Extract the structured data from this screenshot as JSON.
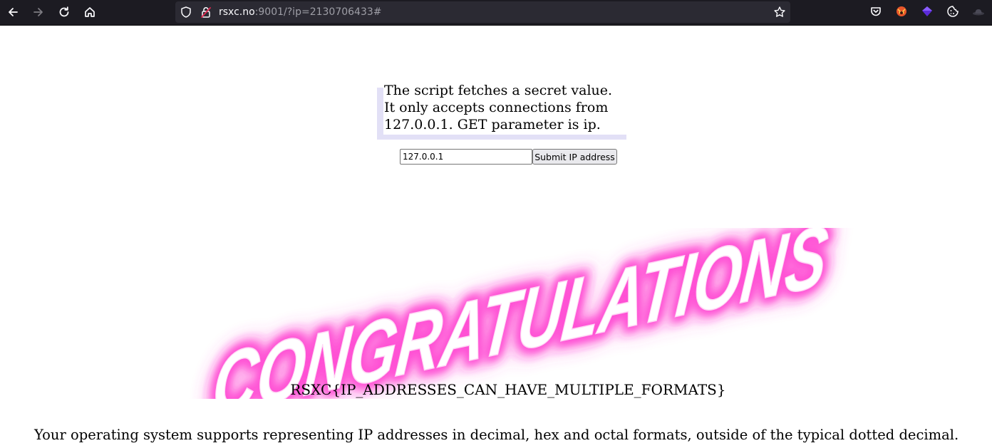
{
  "browser": {
    "url_host": "rsxc.no",
    "url_rest": ":9001/?ip=2130706433#",
    "icons": {
      "back": "back-arrow-icon",
      "forward": "forward-arrow-icon",
      "reload": "reload-icon",
      "home": "home-icon",
      "shield": "tracking-shield-icon",
      "lock": "insecure-lock-icon",
      "bookmark": "bookmark-star-icon",
      "pocket": "pocket-icon",
      "ext1": "extension-fox-icon",
      "ext2": "extension-purple-icon",
      "ext3": "cookie-icon",
      "ext4": "extension-hat-icon"
    }
  },
  "page": {
    "description": "The script fetches a secret value.\nIt only accepts connections from\n127.0.0.1. GET parameter is ip.",
    "ip_input_value": "127.0.0.1",
    "submit_label": "Submit IP address",
    "congrats_word": "CONGRATULATIONS",
    "flag": "RSXC{IP_ADDRESSES_CAN_HAVE_MULTIPLE_FORMATS}",
    "explanation": "Your operating system supports representing IP addresses in decimal, hex and octal formats, outside of the typical dotted decimal."
  },
  "colors": {
    "toolbar_bg": "#1c1b22",
    "urlbar_bg": "#2b2a33",
    "quote_border": "#e2e0f6",
    "neon_glow": "#ff3fd0"
  }
}
